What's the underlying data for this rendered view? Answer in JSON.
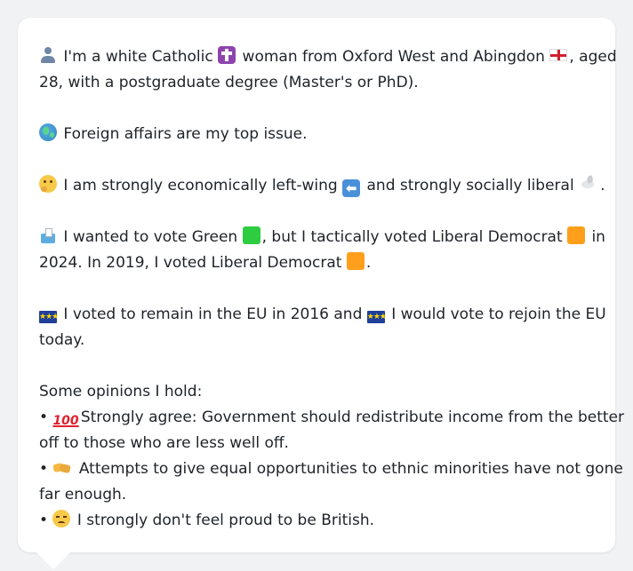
{
  "profile": {
    "line1_a": "I'm a white Catholic",
    "line1_b": "woman from Oxford West and Abingdon",
    "line1_c": ", aged",
    "line2": "28, with a postgraduate degree (Master's or PhD)."
  },
  "issue": {
    "text": "Foreign affairs are my top issue."
  },
  "ideology": {
    "text_a": "I am strongly economically left-wing",
    "text_b": "and strongly socially liberal",
    "text_c": "."
  },
  "vote": {
    "line1_a": "I wanted to vote Green",
    "line1_b": ", but I tactically voted Liberal Democrat",
    "line1_c": "in",
    "line2_a": "2024. In 2019, I voted Liberal Democrat",
    "line2_b": "."
  },
  "eu": {
    "line1_a": "I voted to remain in the EU in 2016 and",
    "line1_b": "I would vote to rejoin the EU",
    "line2": "today.",
    "flag_stars": "★★★"
  },
  "opinions": {
    "heading": "Some opinions I hold:",
    "bullet": "•",
    "hundred": "100",
    "op1_line1": "Strongly agree: Government should redistribute income from the better",
    "op1_line2": "off to those who are less well off.",
    "op2_line1": "Attempts to give equal opportunities to ethnic minorities have not gone",
    "op2_line2": "far enough.",
    "op3_line1": "I strongly don't feel proud to be British."
  },
  "icons": {
    "left_arrow": "⬅"
  },
  "colors": {
    "background": "#f1f2f4",
    "card": "#ffffff",
    "text": "#1f2328",
    "green_party": "#2ecc40",
    "libdem": "#ff9f1c",
    "eu_blue": "#1f3f9a"
  }
}
